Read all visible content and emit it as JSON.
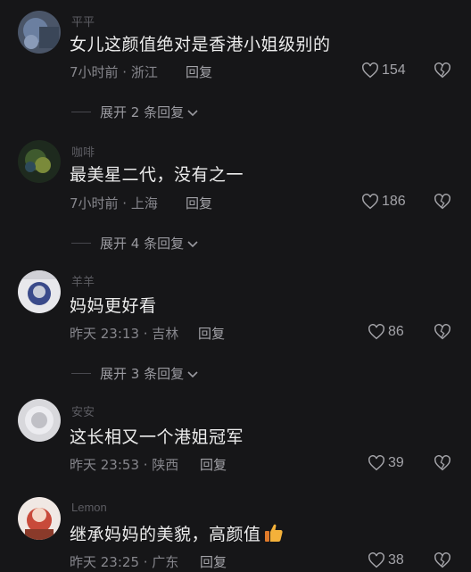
{
  "comments": [
    {
      "username": "平平",
      "text": "女儿这颜值绝对是香港小姐级别的",
      "time_location": "7小时前 · 浙江",
      "reply_label": "回复",
      "likes": "154",
      "expand_label": "展开 2 条回复"
    },
    {
      "username": "咖啡",
      "text": "最美星二代，没有之一",
      "time_location": "7小时前 · 上海",
      "reply_label": "回复",
      "likes": "186",
      "expand_label": "展开 4 条回复"
    },
    {
      "username": "羊羊",
      "text": "妈妈更好看",
      "time_location": "昨天 23:13 · 吉林",
      "reply_label": "回复",
      "likes": "86",
      "expand_label": "展开 3 条回复"
    },
    {
      "username": "安安",
      "text": "这长相又一个港姐冠军",
      "time_location": "昨天 23:53 · 陕西",
      "reply_label": "回复",
      "likes": "39"
    },
    {
      "username": "Lemon",
      "text": "继承妈妈的美貌，高颜值",
      "time_location": "昨天 23:25 · 广东",
      "reply_label": "回复",
      "likes": "38"
    }
  ],
  "icons": {
    "like": "heart-outline-icon",
    "dislike": "broken-heart-icon",
    "expand": "chevron-down-icon",
    "emoji": "thumbs-up-emoji"
  },
  "colors": {
    "background": "#161618",
    "text": "#ececec",
    "meta": "#86868c"
  }
}
